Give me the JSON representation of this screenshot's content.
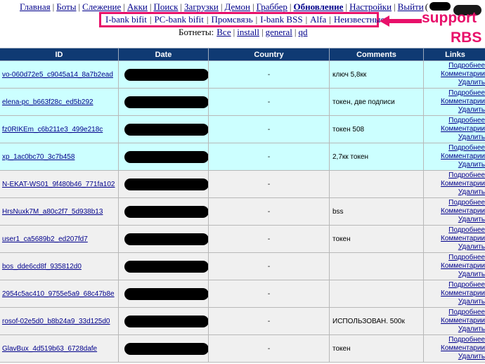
{
  "nav": {
    "items": [
      {
        "label": "Главная",
        "bold": false
      },
      {
        "label": "Боты",
        "bold": false
      },
      {
        "label": "Слежение",
        "bold": false
      },
      {
        "label": "Акки",
        "bold": false
      },
      {
        "label": "Поиск",
        "bold": false
      },
      {
        "label": "Загрузки",
        "bold": false
      },
      {
        "label": "Демон",
        "bold": false
      },
      {
        "label": "Граббер",
        "bold": false
      },
      {
        "label": "Обновление",
        "bold": true
      },
      {
        "label": "Настройки",
        "bold": false
      },
      {
        "label": "Выйти",
        "bold": false
      }
    ],
    "logout_paren": "("
  },
  "subnav": {
    "items": [
      "I-bank bifit",
      "PC-bank bifit",
      "Промсвязь",
      "I-bank BSS",
      "Alfa",
      "Неизвестные"
    ],
    "highlight_color": "#e8106a"
  },
  "annotation": {
    "line1": "support",
    "line2": "RBS",
    "color": "#e8106a"
  },
  "botnets": {
    "label": "Ботнеты:",
    "items": [
      "Все",
      "install",
      "general",
      "qd"
    ]
  },
  "table": {
    "headers": {
      "id": "ID",
      "date": "Date",
      "country": "Country",
      "comments": "Comments",
      "links": "Links"
    },
    "link_labels": {
      "details": "Подробнее",
      "comments": "Комментарии",
      "delete": "Удалить"
    },
    "rows": [
      {
        "id": "vo-060d72e5_c9045a14_8a7b2ead",
        "country": "-",
        "comment": "ключ 5,8кк",
        "style": "cyan"
      },
      {
        "id": "elena-pc_b663f28c_ed5b292",
        "country": "-",
        "comment": "токен, две подписи",
        "style": "cyan"
      },
      {
        "id": "fz0RIKEm_c6b211e3_499e218c",
        "country": "-",
        "comment": "токен 508",
        "style": "cyan"
      },
      {
        "id": "xp_1ac0bc70_3c7b458",
        "country": "-",
        "comment": "2,7кк токен",
        "style": "cyan"
      },
      {
        "id": "N-EKAT-WS01_9f480b46_771fa102",
        "country": "-",
        "comment": "",
        "style": "gray"
      },
      {
        "id": "HrsNuxk7M_a80c2f7_5d938b13",
        "country": "-",
        "comment": "bss",
        "style": "gray"
      },
      {
        "id": "user1_ca5689b2_ed207fd7",
        "country": "-",
        "comment": "токен",
        "style": "gray"
      },
      {
        "id": "bos_dde6cd8f_935812d0",
        "country": "-",
        "comment": "",
        "style": "gray"
      },
      {
        "id": "2954c5ac410_9755e5a9_68c47b8e",
        "country": "-",
        "comment": "",
        "style": "gray"
      },
      {
        "id": "rosof-02e5d0_b8b24a9_33d125d0",
        "country": "-",
        "comment": "ИСПОЛЬЗОВАН. 500к",
        "style": "gray"
      },
      {
        "id": "GlavBux_4d519b63_6728dafe",
        "country": "-",
        "comment": "токен",
        "style": "gray"
      }
    ]
  },
  "colors": {
    "header_bg": "#0f3a73",
    "row_cyan": "#ccffff",
    "row_gray": "#f0f0f0",
    "link": "#00008b"
  }
}
